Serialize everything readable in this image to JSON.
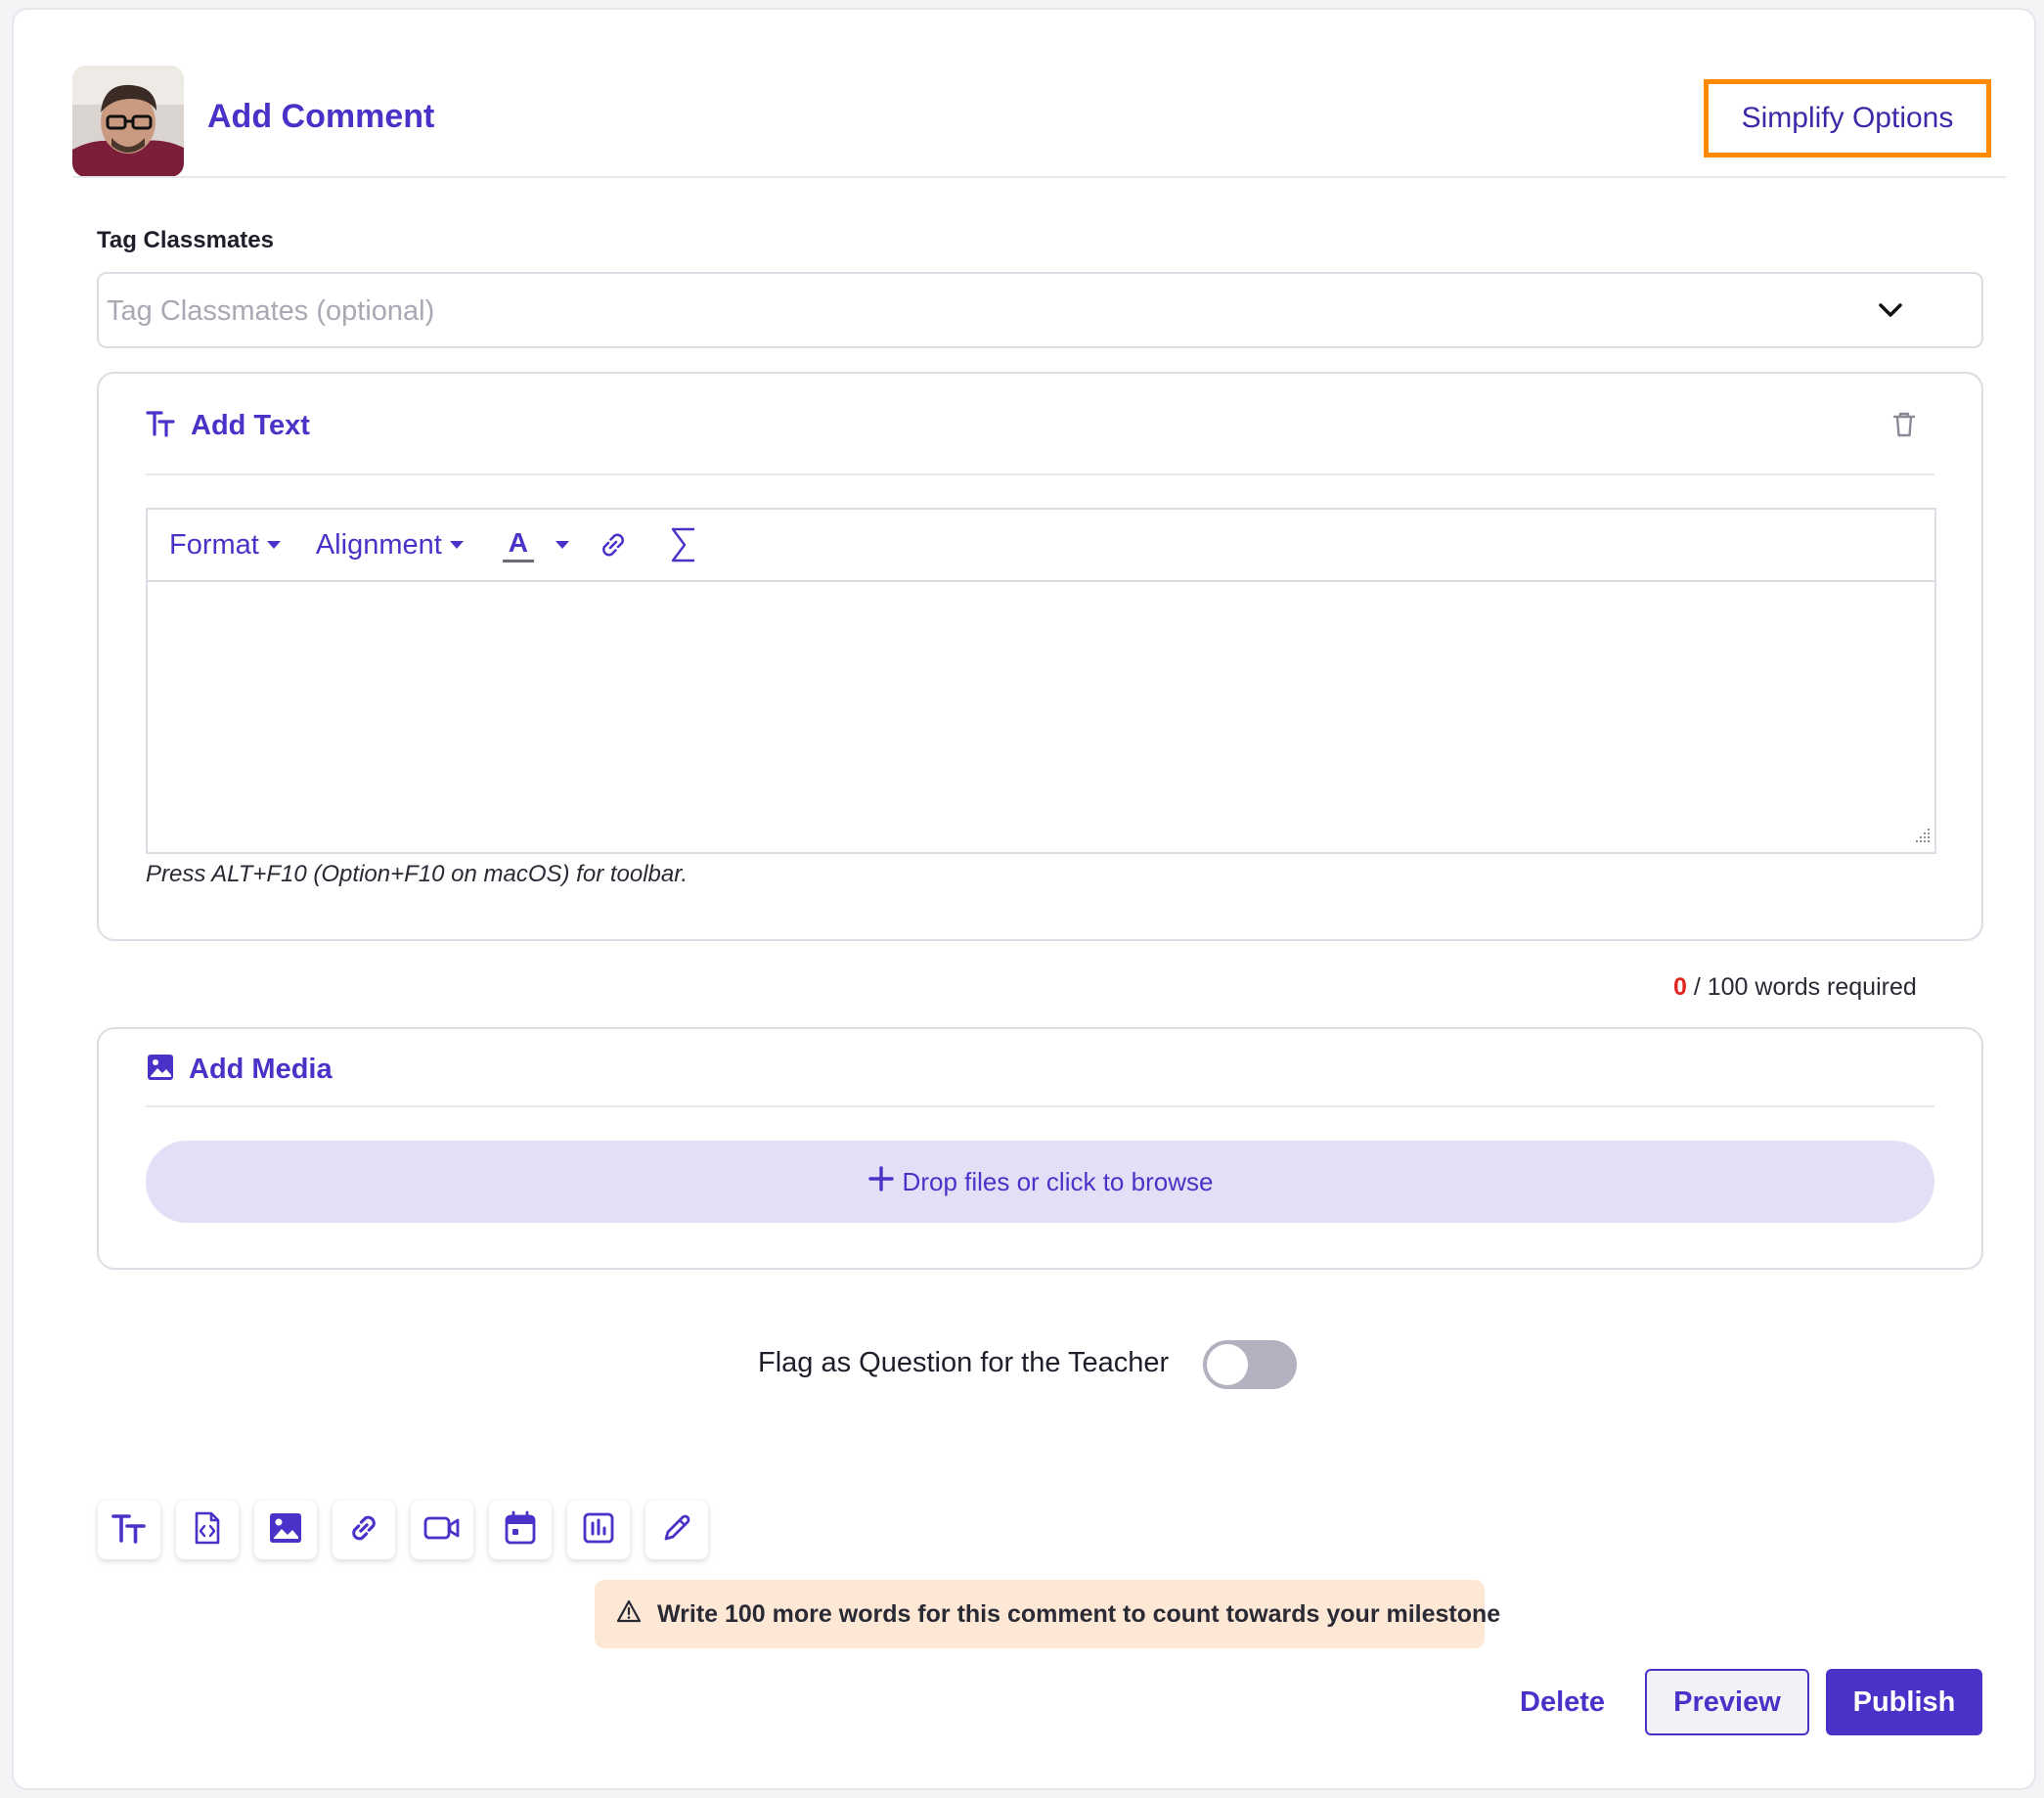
{
  "header": {
    "title": "Add Comment",
    "simplify_label": "Simplify Options"
  },
  "tag": {
    "label": "Tag Classmates",
    "placeholder": "Tag Classmates (optional)"
  },
  "text_panel": {
    "label": "Add Text",
    "toolbar": {
      "format_label": "Format",
      "alignment_label": "Alignment",
      "font_color_glyph": "A"
    },
    "hint": "Press ALT+F10 (Option+F10 on macOS) for toolbar."
  },
  "word_count": {
    "current": "0",
    "suffix": "/ 100 words required"
  },
  "media_panel": {
    "label": "Add Media",
    "drop_label": "Drop files or click to browse"
  },
  "flag": {
    "label": "Flag as Question for the Teacher",
    "enabled": false
  },
  "blocks": [
    "text-icon",
    "embed-code-icon",
    "image-icon",
    "link-icon",
    "video-icon",
    "calendar-icon",
    "chart-icon",
    "pencil-icon"
  ],
  "warning": {
    "prefix": "Write ",
    "count": "100",
    "suffix": " more words for this comment to count towards your milestone"
  },
  "actions": {
    "delete_label": "Delete",
    "preview_label": "Preview",
    "publish_label": "Publish"
  },
  "colors": {
    "accent": "#4a32c8",
    "highlight": "#ff8a00",
    "error": "#e0261f",
    "warning_bg": "#fde8d6",
    "drop_bg": "#e2e0f7"
  }
}
